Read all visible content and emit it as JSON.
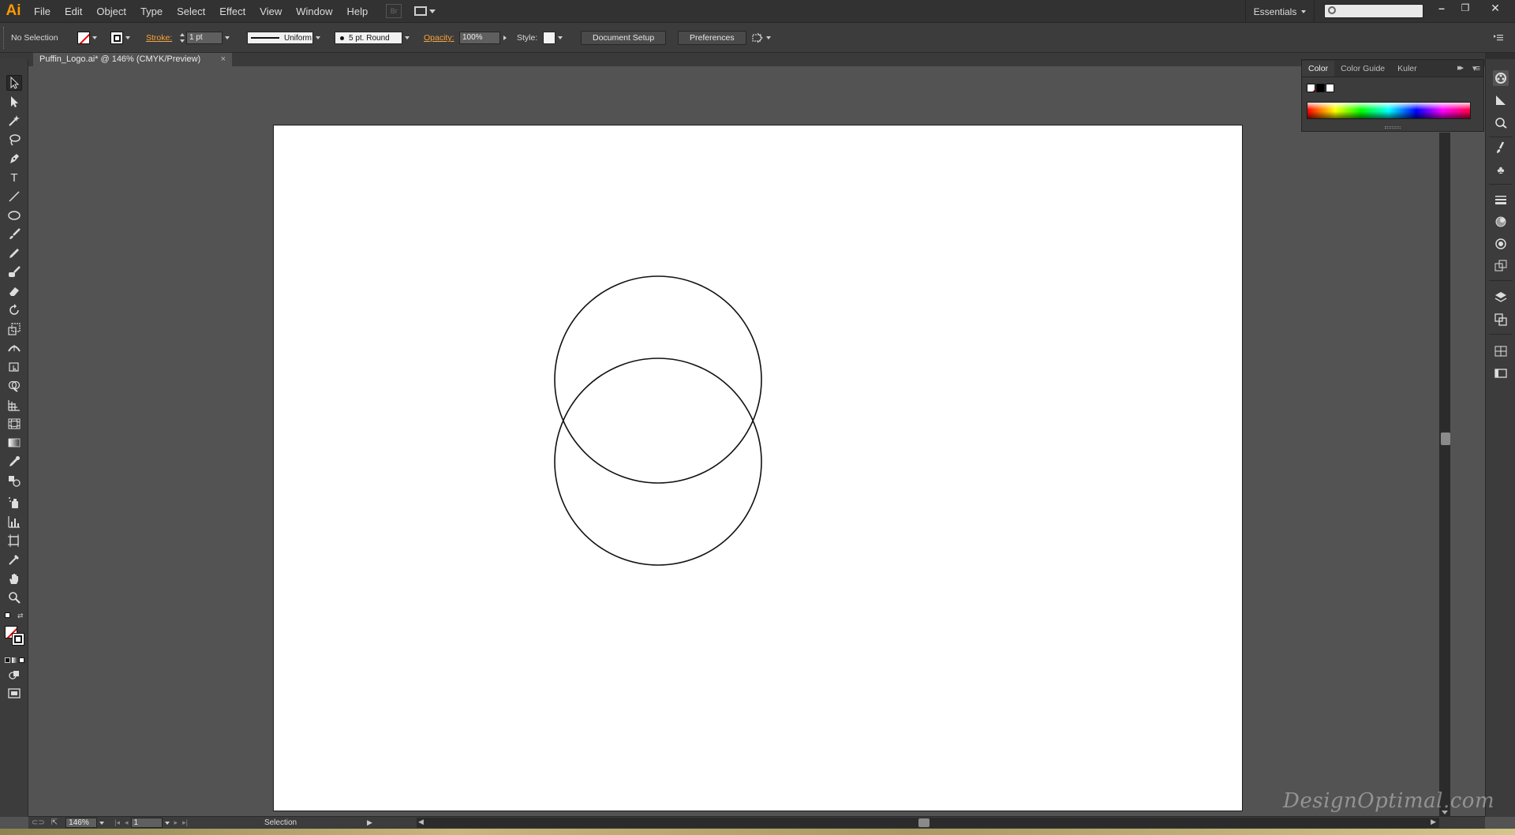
{
  "app": {
    "logo": "Ai",
    "workspace": "Essentials",
    "search_placeholder": ""
  },
  "menu": [
    "File",
    "Edit",
    "Object",
    "Type",
    "Select",
    "Effect",
    "View",
    "Window",
    "Help"
  ],
  "bridge_label": "Br",
  "window_controls": {
    "minimize": "–",
    "restore": "❐",
    "close": "✕"
  },
  "controlbar": {
    "selection": "No Selection",
    "stroke_label": "Stroke:",
    "stroke_weight": "1 pt",
    "variable_width": "Uniform",
    "brush": "5 pt. Round",
    "opacity_label": "Opacity:",
    "opacity_value": "100%",
    "style_label": "Style:",
    "document_setup": "Document Setup",
    "preferences": "Preferences"
  },
  "document_tab": {
    "title": "Puffin_Logo.ai* @ 146% (CMYK/Preview)",
    "close": "×"
  },
  "color_panel": {
    "tabs": [
      "Color",
      "Color Guide",
      "Kuler"
    ],
    "active_tab": "Color"
  },
  "statusbar": {
    "zoom": "146%",
    "artboard": "1",
    "tool": "Selection"
  },
  "watermark": "DesignOptimal.com",
  "colors": {
    "menubar": "#323232",
    "panel": "#3c3c3c",
    "pasteboard": "#535353",
    "accent": "#ff9a00",
    "label_orange": "#f7a33c"
  },
  "icons": {
    "tools": [
      "selection-tool-icon",
      "direct-selection-tool-icon",
      "magic-wand-tool-icon",
      "lasso-tool-icon",
      "pen-tool-icon",
      "type-tool-icon",
      "line-tool-icon",
      "ellipse-tool-icon",
      "paintbrush-tool-icon",
      "pencil-tool-icon",
      "blob-brush-tool-icon",
      "eraser-tool-icon",
      "rotate-tool-icon",
      "scale-tool-icon",
      "width-tool-icon",
      "free-transform-tool-icon",
      "shape-builder-tool-icon",
      "perspective-grid-tool-icon",
      "mesh-tool-icon",
      "gradient-tool-icon",
      "eyedropper-tool-icon",
      "blend-tool-icon",
      "symbol-sprayer-tool-icon",
      "graph-tool-icon",
      "artboard-tool-icon",
      "slice-tool-icon",
      "hand-tool-icon",
      "zoom-tool-icon"
    ],
    "dock": [
      "color-panel-icon",
      "color-guide-icon",
      "appearance-icon",
      "brushes-icon",
      "symbols-icon",
      "stroke-icon",
      "gradient-icon",
      "transparency-icon",
      "graphic-styles-icon",
      "layers-icon",
      "artboards-icon",
      "align-icon",
      "transform-icon"
    ]
  }
}
